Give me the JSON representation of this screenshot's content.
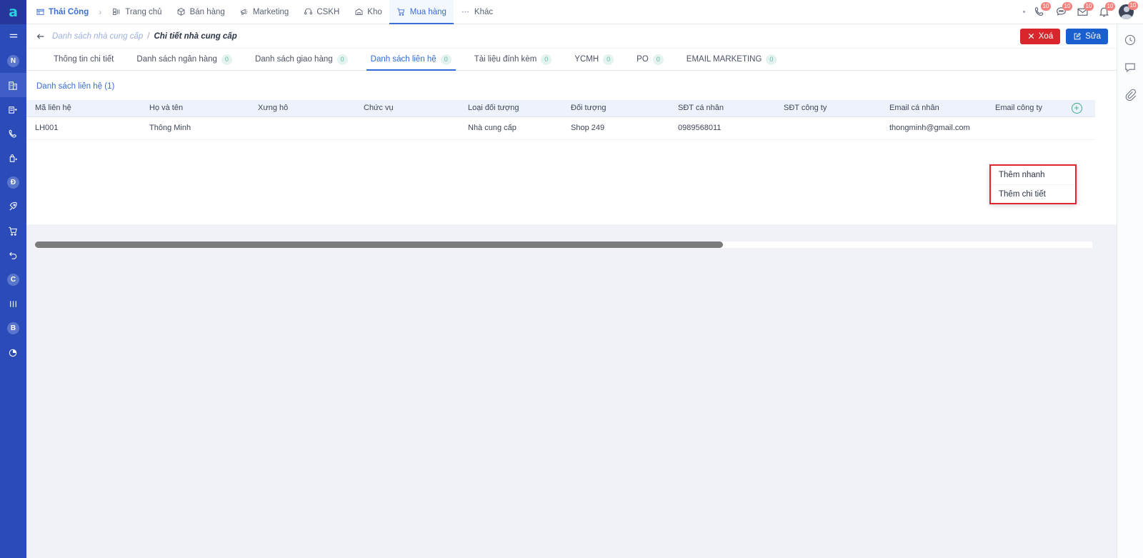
{
  "app": {
    "logo_letter": "a"
  },
  "topnav": {
    "items": [
      {
        "label": "Thái Công",
        "icon": "store-icon",
        "active": false,
        "brand": true
      },
      {
        "label": "Trang chủ",
        "icon": "dashboard-icon",
        "active": false
      },
      {
        "label": "Bán hàng",
        "icon": "box-icon",
        "active": false
      },
      {
        "label": "Marketing",
        "icon": "megaphone-icon",
        "active": false
      },
      {
        "label": "CSKH",
        "icon": "headset-icon",
        "active": false
      },
      {
        "label": "Kho",
        "icon": "warehouse-icon",
        "active": false
      },
      {
        "label": "Mua hàng",
        "icon": "cart-icon",
        "active": true
      },
      {
        "label": "Khác",
        "icon": "ellipsis-icon",
        "active": false
      }
    ],
    "status_icons": [
      {
        "name": "phone-icon",
        "badge": "10"
      },
      {
        "name": "chat-icon",
        "badge": "10"
      },
      {
        "name": "mail-icon",
        "badge": "10"
      },
      {
        "name": "bell-icon",
        "badge": "10"
      },
      {
        "name": "avatar",
        "badge": "10"
      }
    ]
  },
  "left_rail": {
    "items": [
      {
        "name": "menu-toggle-icon",
        "label": "menu"
      },
      {
        "name": "badge-n-icon",
        "label": "N"
      },
      {
        "name": "building-icon",
        "label": "company",
        "active": true
      },
      {
        "name": "branch-icon",
        "label": "branch"
      },
      {
        "name": "phone-icon",
        "label": "call"
      },
      {
        "name": "bag-icon",
        "label": "bag"
      },
      {
        "name": "badge-d-icon",
        "label": "Đ"
      },
      {
        "name": "rocket-icon",
        "label": "rocket"
      },
      {
        "name": "cart-icon",
        "label": "cart"
      },
      {
        "name": "undo-icon",
        "label": "undo"
      },
      {
        "name": "badge-c-icon",
        "label": "C"
      },
      {
        "name": "columns-icon",
        "label": "columns"
      },
      {
        "name": "badge-b-icon",
        "label": "B"
      },
      {
        "name": "pie-icon",
        "label": "report"
      }
    ]
  },
  "right_rail": {
    "items": [
      {
        "name": "history-clock-icon"
      },
      {
        "name": "comment-icon"
      },
      {
        "name": "attachment-icon"
      }
    ]
  },
  "breadcrumb": {
    "back_icon": "back-arrow-icon",
    "parent": "Danh sách nhà cung cấp",
    "separator": "/",
    "current": "Chi tiết nhà cung cấp"
  },
  "actions": {
    "delete_label": "Xoá",
    "delete_icon": "close-icon",
    "edit_label": "Sửa",
    "edit_icon": "pencil-square-icon",
    "delete_color": "#d9262c",
    "edit_color": "#1a5fd0"
  },
  "tabs": [
    {
      "label": "Thông tin chi tiết",
      "badge": null,
      "active": false
    },
    {
      "label": "Danh sách ngân hàng",
      "badge": "0",
      "active": false
    },
    {
      "label": "Danh sách giao hàng",
      "badge": "0",
      "active": false
    },
    {
      "label": "Danh sách liên hệ",
      "badge": "0",
      "active": true
    },
    {
      "label": "Tài liệu đính kèm",
      "badge": "0",
      "active": false
    },
    {
      "label": "YCMH",
      "badge": "0",
      "active": false
    },
    {
      "label": "PO",
      "badge": "0",
      "active": false
    },
    {
      "label": "EMAIL MARKETING",
      "badge": "0",
      "active": false
    }
  ],
  "panel": {
    "title": "Danh sách liên hệ (1)",
    "add_icon": "plus-circle-icon",
    "columns": [
      "Mã liên hệ",
      "Họ và tên",
      "Xưng hô",
      "Chức vụ",
      "Loại đối tượng",
      "Đối tượng",
      "SĐT cá nhân",
      "SĐT công ty",
      "Email cá nhân",
      "Email công ty"
    ],
    "rows": [
      {
        "ma_lien_he": "LH001",
        "ho_va_ten": "Thông Minh",
        "xung_ho": "",
        "chuc_vu": "",
        "loai_doi_tuong": "Nhà cung cấp",
        "doi_tuong": "Shop 249",
        "sdt_ca_nhan": "0989568011",
        "sdt_cong_ty": "",
        "email_ca_nhan": "thongminh@gmail.com",
        "email_cong_ty": ""
      }
    ]
  },
  "dropdown": {
    "items": [
      {
        "label": "Thêm nhanh"
      },
      {
        "label": "Thêm chi tiết"
      }
    ],
    "border_color": "#e0262c"
  }
}
